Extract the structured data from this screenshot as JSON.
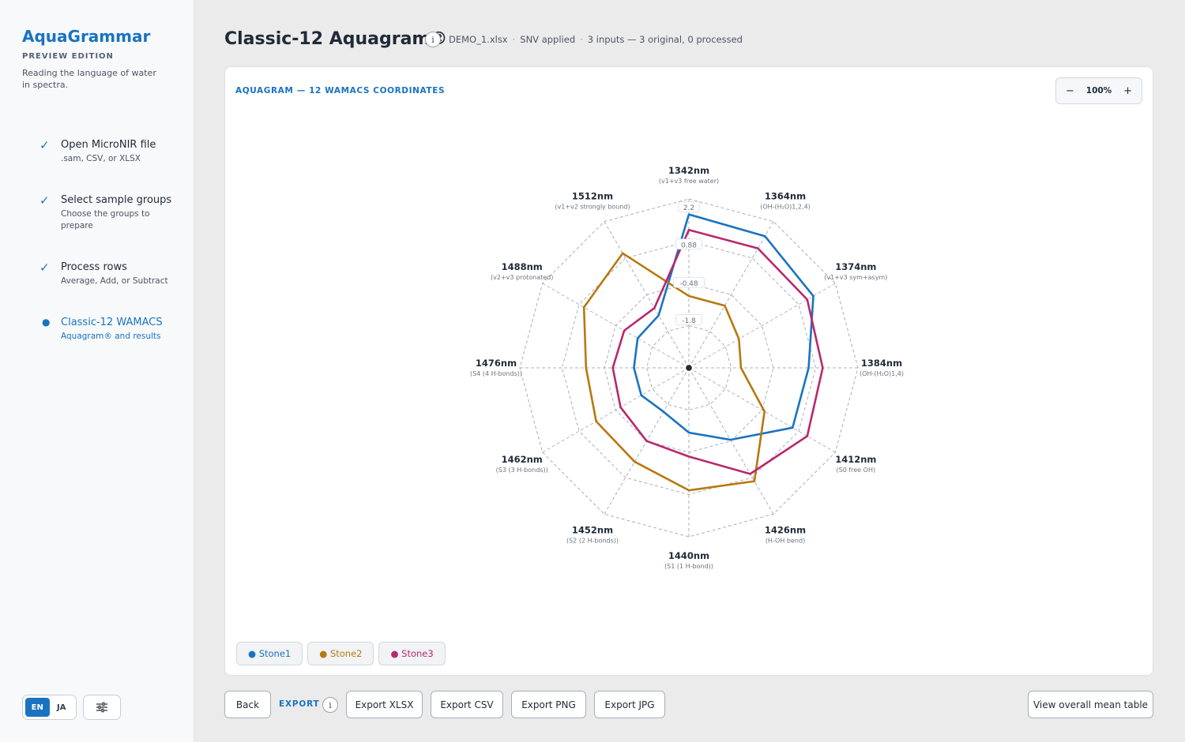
{
  "app": {
    "name": "AquaGrammar",
    "edition": "PREVIEW EDITION",
    "tagline": "Reading the language of water in spectra."
  },
  "steps": [
    {
      "title": "Open MicroNIR file",
      "subtitle": ".sam, CSV, or XLSX",
      "status": "done"
    },
    {
      "title": "Select sample groups",
      "subtitle": "Choose the groups to prepare",
      "status": "done"
    },
    {
      "title": "Process rows",
      "subtitle": "Average, Add, or Subtract",
      "status": "done"
    },
    {
      "title": "Classic-12 WAMACS",
      "subtitle": "Aquagram® and results",
      "status": "active"
    }
  ],
  "language": {
    "en": "EN",
    "ja": "JA",
    "selected": "EN"
  },
  "header": {
    "title": "Classic-12 Aquagram®",
    "info": "i",
    "file": "DEMO_1.xlsx",
    "preprocess": "SNV applied",
    "inputs": "3 inputs — 3 original, 0 processed"
  },
  "card": {
    "title": "AQUAGRAM — 12 WAMACS COORDINATES",
    "zoom": {
      "minus": "−",
      "value": "100%",
      "plus": "+"
    }
  },
  "chart_data": {
    "type": "radar",
    "axes": [
      {
        "label": "1342nm",
        "sub": "(v1+v3 free water)"
      },
      {
        "label": "1364nm",
        "sub": "(OH-(H₂O)1,2,4)"
      },
      {
        "label": "1374nm",
        "sub": "(v1+v3 sym+asym)"
      },
      {
        "label": "1384nm",
        "sub": "(OH-(H₂O)1,4)"
      },
      {
        "label": "1412nm",
        "sub": "(S0 free OH)"
      },
      {
        "label": "1426nm",
        "sub": "(H-OH bend)"
      },
      {
        "label": "1440nm",
        "sub": "(S1 (1 H-bond))"
      },
      {
        "label": "1452nm",
        "sub": "(S2 (2 H-bonds))"
      },
      {
        "label": "1462nm",
        "sub": "(S3 (3 H-bonds))"
      },
      {
        "label": "1476nm",
        "sub": "(S4 (4 H-bonds))"
      },
      {
        "label": "1488nm",
        "sub": "(v2+v3 protonated)"
      },
      {
        "label": "1512nm",
        "sub": "(v1+v2 strongly bound)"
      }
    ],
    "range": [
      -3.5,
      2.5
    ],
    "ticks": [
      "2.2",
      "0.88",
      "-0.48",
      "-1.8"
    ],
    "tick_values": [
      2.2,
      0.88,
      -0.48,
      -1.8
    ],
    "grid": true,
    "series": [
      {
        "name": "Stone1",
        "color": "#1a73c0",
        "values": [
          1.95,
          1.9,
          1.6,
          0.75,
          0.75,
          -0.55,
          -1.2,
          -1.7,
          -1.55,
          -1.55,
          -1.4,
          -1.35
        ]
      },
      {
        "name": "Stone2",
        "color": "#b87810",
        "values": [
          -0.95,
          -0.95,
          -1.45,
          -1.65,
          -0.4,
          1.15,
          0.85,
          0.35,
          0.3,
          0.15,
          0.8,
          1.2
        ]
      },
      {
        "name": "Stone3",
        "color": "#b8286e",
        "values": [
          1.4,
          1.4,
          1.35,
          1.25,
          1.35,
          0.85,
          -0.35,
          -0.5,
          -0.7,
          -0.8,
          -0.85,
          -1.05
        ]
      }
    ]
  },
  "legend": [
    {
      "name": "Stone1",
      "color": "#1a73c0"
    },
    {
      "name": "Stone2",
      "color": "#b87810"
    },
    {
      "name": "Stone3",
      "color": "#b8286e"
    }
  ],
  "footer": {
    "back": "Back",
    "export_label": "EXPORT",
    "export_xlsx": "Export XLSX",
    "export_csv": "Export CSV",
    "export_png": "Export PNG",
    "export_jpg": "Export JPG",
    "mean_table": "View overall mean table"
  }
}
